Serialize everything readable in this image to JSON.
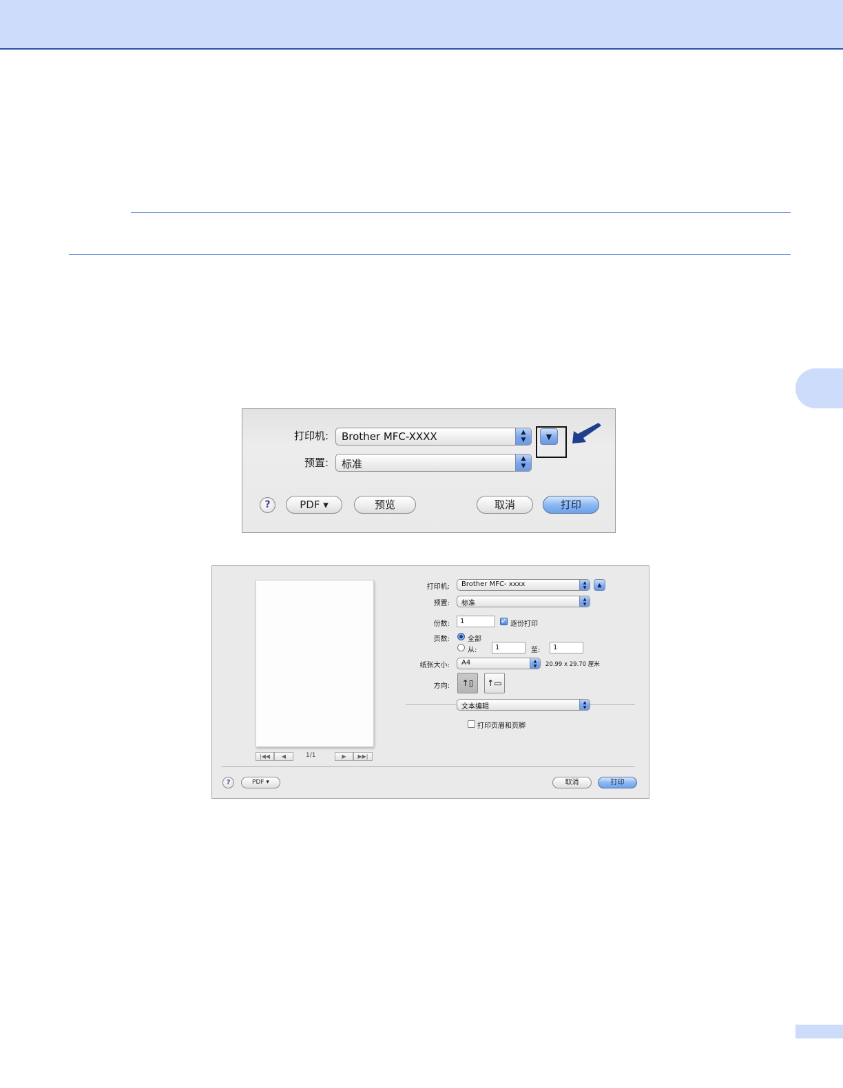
{
  "colors": {
    "accent_band": "#cddcfb",
    "rule": "#6f95dc",
    "arrow": "#1f3e8c"
  },
  "dialog_compact": {
    "printer_label": "打印机:",
    "printer_value": "Brother MFC-XXXX",
    "preset_label": "预置:",
    "preset_value": "标准",
    "expand_icon": "triangle-down-icon",
    "help_label": "?",
    "pdf_label": "PDF ▾",
    "preview_label": "预览",
    "cancel_label": "取消",
    "print_label": "打印"
  },
  "dialog_expanded": {
    "page_counter": "1/1",
    "printer_label": "打印机:",
    "printer_value": "Brother MFC- xxxx",
    "preset_label": "预置:",
    "preset_value": "标准",
    "copies_label": "份数:",
    "copies_value": "1",
    "collate_label": "逐份打印",
    "collate_checked": true,
    "pages_label": "页数:",
    "pages_all_label": "全部",
    "pages_from_label": "从:",
    "pages_from_value": "1",
    "pages_to_label": "至:",
    "pages_to_value": "1",
    "paper_size_label": "纸张大小:",
    "paper_size_value": "A4",
    "paper_dimensions": "20.99 x 29.70 厘米",
    "orientation_label": "方向:",
    "section_popup_value": "文本编辑",
    "headers_footers_label": "打印页眉和页脚",
    "headers_footers_checked": false,
    "help_label": "?",
    "pdf_label": "PDF ▾",
    "cancel_label": "取消",
    "print_label": "打印"
  }
}
